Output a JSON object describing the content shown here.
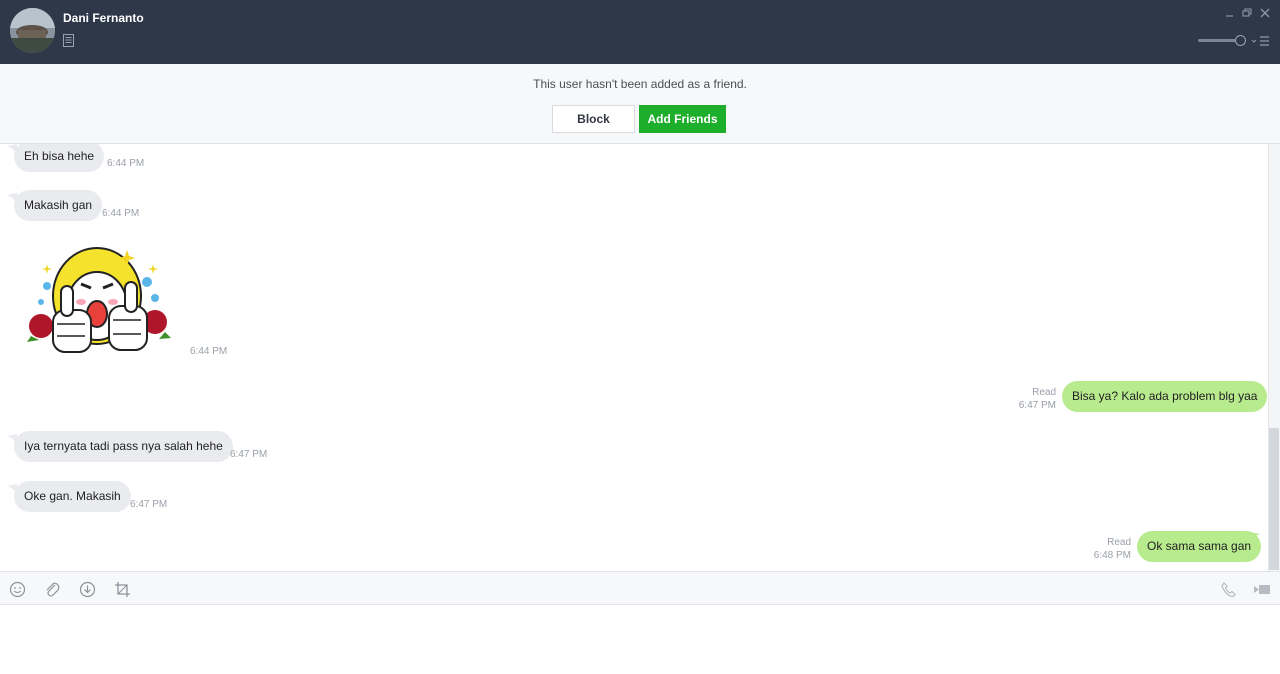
{
  "header": {
    "contact_name": "Dani Fernanto",
    "background_color": "#2e3849",
    "icons": [
      "note-icon",
      "minimize-icon",
      "restore-icon",
      "close-icon",
      "volume-slider",
      "menu-icon"
    ]
  },
  "banner": {
    "message": "This user hasn't been added as a friend.",
    "block_label": "Block",
    "add_label": "Add Friends",
    "add_color": "#1dae2c"
  },
  "messages": [
    {
      "direction": "in",
      "text": "Eh bisa hehe",
      "time": "6:44 PM"
    },
    {
      "direction": "in",
      "text": "Makasih gan",
      "time": "6:44 PM"
    },
    {
      "direction": "in",
      "type": "sticker",
      "time": "6:44 PM"
    },
    {
      "direction": "out",
      "text": "Bisa ya? Kalo ada problem blg yaa",
      "status": "Read",
      "time": "6:47 PM"
    },
    {
      "direction": "in",
      "text": "Iya ternyata tadi pass nya salah hehe",
      "time": "6:47 PM"
    },
    {
      "direction": "in",
      "text": "Oke gan. Makasih",
      "time": "6:47 PM"
    },
    {
      "direction": "out",
      "text": "Ok sama sama gan",
      "status": "Read",
      "time": "6:48 PM"
    }
  ],
  "colors": {
    "incoming_bubble": "#e9ebee",
    "outgoing_bubble": "#b8ea8e"
  },
  "toolbar": {
    "icons": [
      "emoji-icon",
      "attach-icon",
      "download-icon",
      "crop-icon",
      "call-icon",
      "video-call-icon"
    ]
  }
}
